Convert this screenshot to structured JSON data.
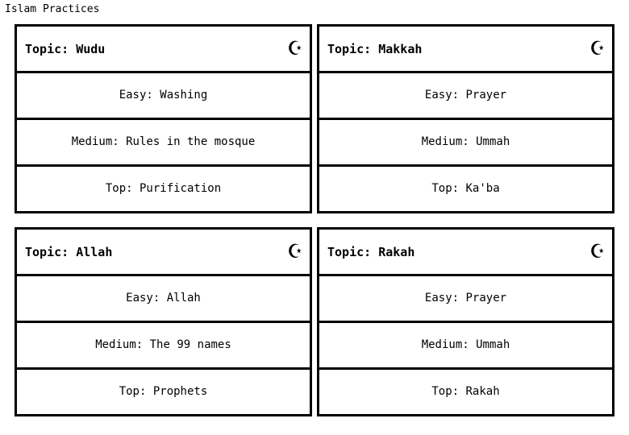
{
  "page_title": "Islam Practices",
  "icon": {
    "name": "star-and-crescent-icon",
    "glyph": "☪"
  },
  "colors": {
    "background": "#ffffff",
    "border": "#000000",
    "text": "#000000"
  },
  "cards": [
    {
      "title": "Topic: Wudu",
      "icon_glyph": "☪",
      "rows": [
        "Easy: Washing",
        "Medium: Rules in the mosque",
        "Top: Purification"
      ]
    },
    {
      "title": "Topic: Makkah",
      "icon_glyph": "☪",
      "rows": [
        "Easy: Prayer",
        "Medium: Ummah",
        "Top: Ka'ba"
      ]
    },
    {
      "title": "Topic: Allah",
      "icon_glyph": "☪",
      "rows": [
        "Easy: Allah",
        "Medium: The 99 names",
        "Top: Prophets"
      ]
    },
    {
      "title": "Topic: Rakah",
      "icon_glyph": "☪",
      "rows": [
        "Easy: Prayer",
        "Medium: Ummah",
        "Top: Rakah"
      ]
    }
  ]
}
